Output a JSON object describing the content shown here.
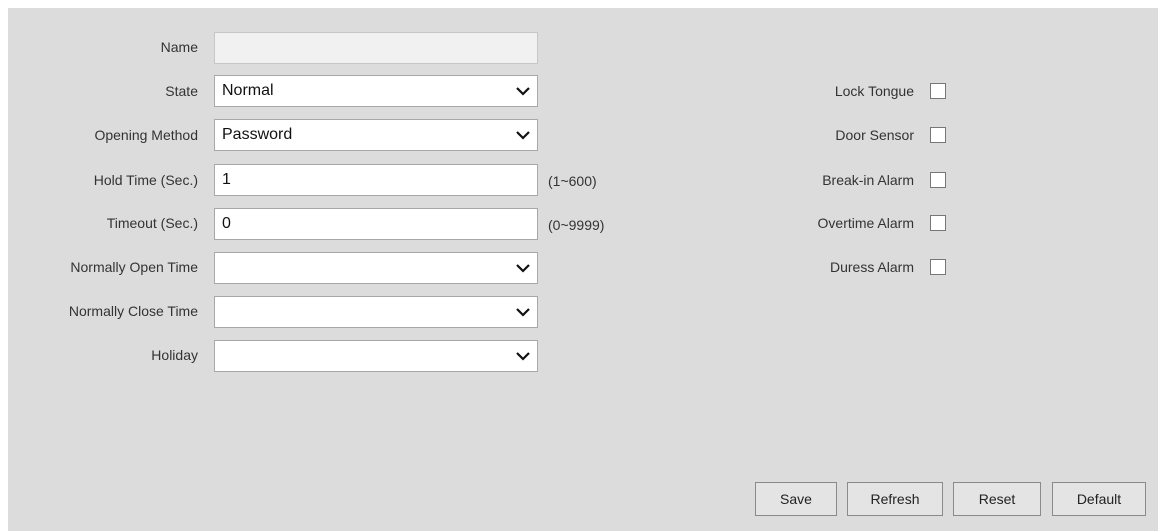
{
  "form": {
    "name": {
      "label": "Name",
      "value": ""
    },
    "state": {
      "label": "State",
      "value": "Normal"
    },
    "opening_method": {
      "label": "Opening Method",
      "value": "Password"
    },
    "hold_time": {
      "label": "Hold Time (Sec.)",
      "value": "1",
      "hint": "(1~600)"
    },
    "timeout": {
      "label": "Timeout (Sec.)",
      "value": "0",
      "hint": "(0~9999)"
    },
    "normally_open_time": {
      "label": "Normally Open Time",
      "value": ""
    },
    "normally_close_time": {
      "label": "Normally Close Time",
      "value": ""
    },
    "holiday": {
      "label": "Holiday",
      "value": ""
    }
  },
  "checkboxes": [
    {
      "label": "Lock Tongue",
      "checked": false
    },
    {
      "label": "Door Sensor",
      "checked": false
    },
    {
      "label": "Break-in Alarm",
      "checked": false
    },
    {
      "label": "Overtime Alarm",
      "checked": false
    },
    {
      "label": "Duress Alarm",
      "checked": false
    }
  ],
  "buttons": {
    "save": "Save",
    "refresh": "Refresh",
    "reset": "Reset",
    "default": "Default"
  },
  "icons": {
    "dropdown": "chevron-down-icon"
  }
}
